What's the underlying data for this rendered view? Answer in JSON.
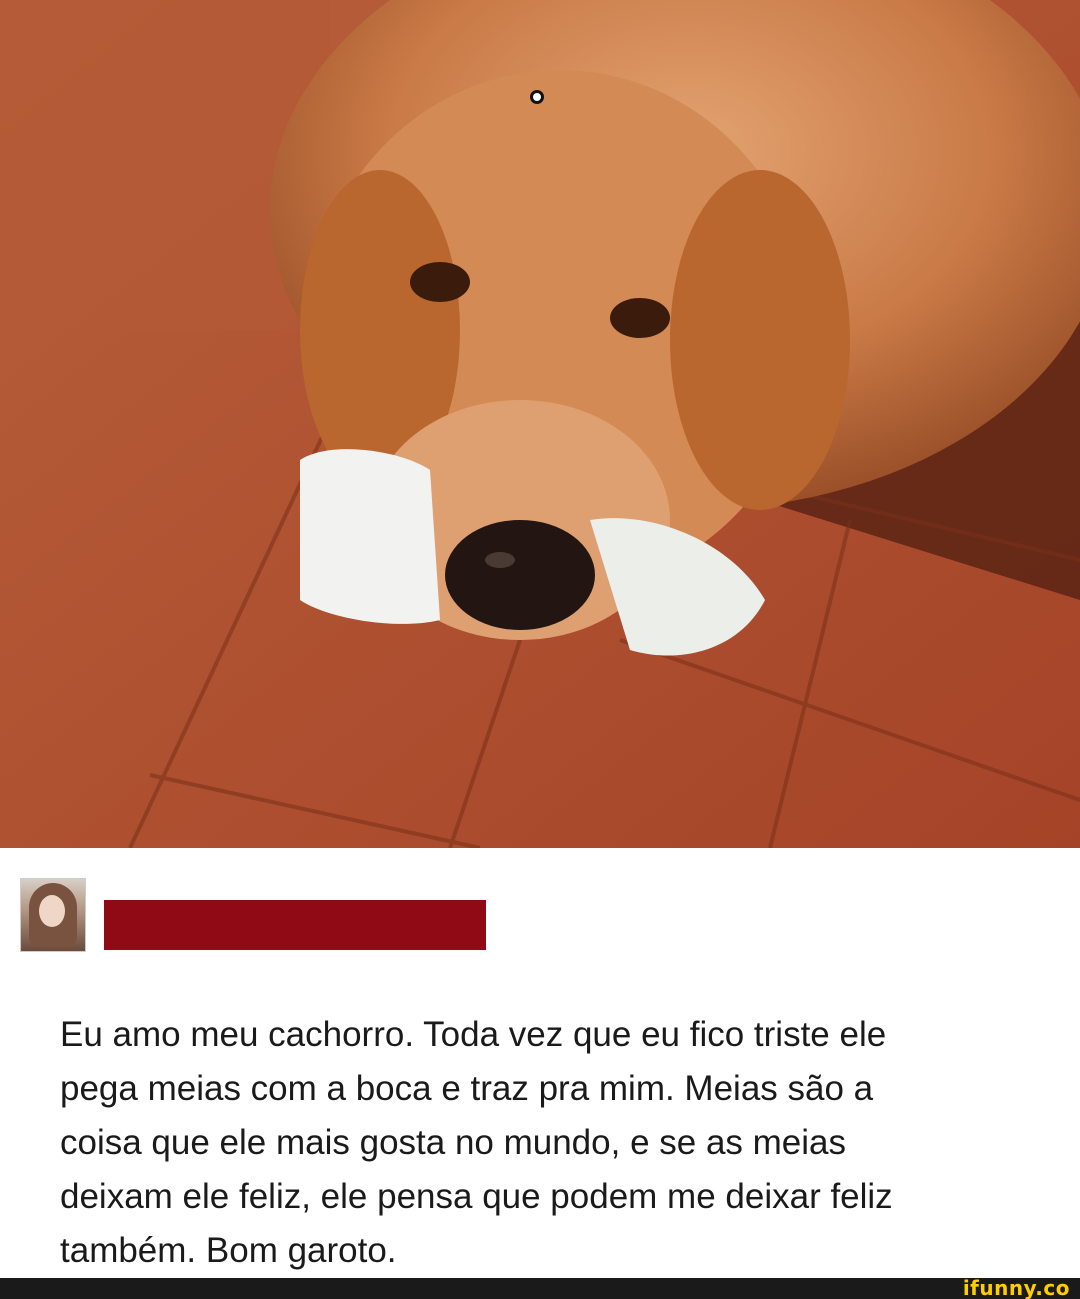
{
  "photo": {
    "subject": "golden retriever holding a white sock"
  },
  "post": {
    "avatar_icon": "profile-picture",
    "redaction_color": "#8f0a14",
    "text_lines": [
      "Eu amo meu cachorro. Toda vez que eu fico triste ele",
      "pega meias com a boca e traz pra mim. Meias são a",
      "coisa que ele mais gosta no mundo, e se as meias",
      "deixam ele feliz, ele pensa que podem me deixar feliz",
      "também. Bom garoto."
    ]
  },
  "footer": {
    "watermark": "ifunny.co"
  },
  "colors": {
    "footer_bg": "#1a1a1a",
    "watermark": "#ffcc00"
  }
}
